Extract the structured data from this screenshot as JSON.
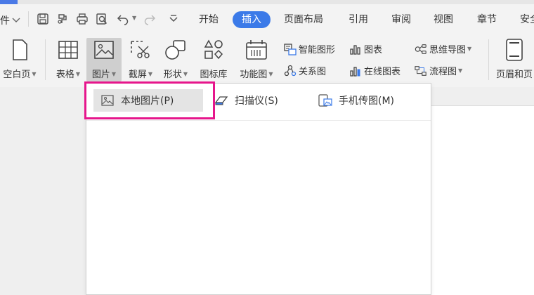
{
  "menu": {
    "left_partial": "件",
    "tabs": [
      {
        "label": "开始",
        "active": false
      },
      {
        "label": "插入",
        "active": true
      },
      {
        "label": "页面布局",
        "active": false
      },
      {
        "label": "引用",
        "active": false
      },
      {
        "label": "审阅",
        "active": false
      },
      {
        "label": "视图",
        "active": false
      },
      {
        "label": "章节",
        "active": false
      },
      {
        "label": "安全",
        "active": false
      }
    ]
  },
  "ribbon": {
    "blank_page": "空白页",
    "table": "表格",
    "picture": "图片",
    "screenshot": "截屏",
    "shape": "形状",
    "icon_library": "图标库",
    "function_chart": "功能图",
    "smart_graphic": "智能图形",
    "chart": "图表",
    "mind_map": "思维导图",
    "relation_chart": "关系图",
    "online_chart": "在线图表",
    "flowchart": "流程图",
    "header_footer": "页眉和页"
  },
  "dropdown": {
    "local_picture": "本地图片(P)",
    "scanner": "扫描仪(S)",
    "phone_picture": "手机传图(M)"
  },
  "colors": {
    "accent": "#3b7ae8",
    "highlight": "#e6168c"
  }
}
